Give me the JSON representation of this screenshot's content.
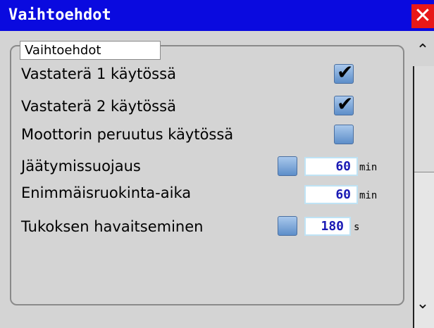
{
  "window": {
    "title": "Vaihtoehdot",
    "close_symbol": "✕"
  },
  "group": {
    "label": "Vaihtoehdot"
  },
  "options": {
    "counter_blade_1": {
      "label": "Vastaterä 1 käytössä",
      "checked": true
    },
    "counter_blade_2": {
      "label": "Vastaterä 2 käytössä",
      "checked": true
    },
    "motor_reverse": {
      "label": "Moottorin peruutus käytössä",
      "checked": false
    },
    "freeze_protection": {
      "label": "Jäätymissuojaus",
      "checked": false,
      "value": "60",
      "unit": "min"
    },
    "max_feed_time": {
      "label": "Enimmäisruokinta-aika",
      "value": "60",
      "unit": "min"
    },
    "jam_detection": {
      "label": "Tukoksen havaitseminen",
      "checked": false,
      "value": "180",
      "unit": "s"
    }
  },
  "checkmark_symbol": "✔",
  "scrollbar": {
    "up_icon": "chevron-up-icon",
    "down_icon": "chevron-down-icon",
    "up_symbol": "⌃",
    "down_symbol": "⌄"
  },
  "colors": {
    "titlebar": "#0a0adf",
    "close": "#e81818",
    "value_text": "#1a1ab4"
  }
}
